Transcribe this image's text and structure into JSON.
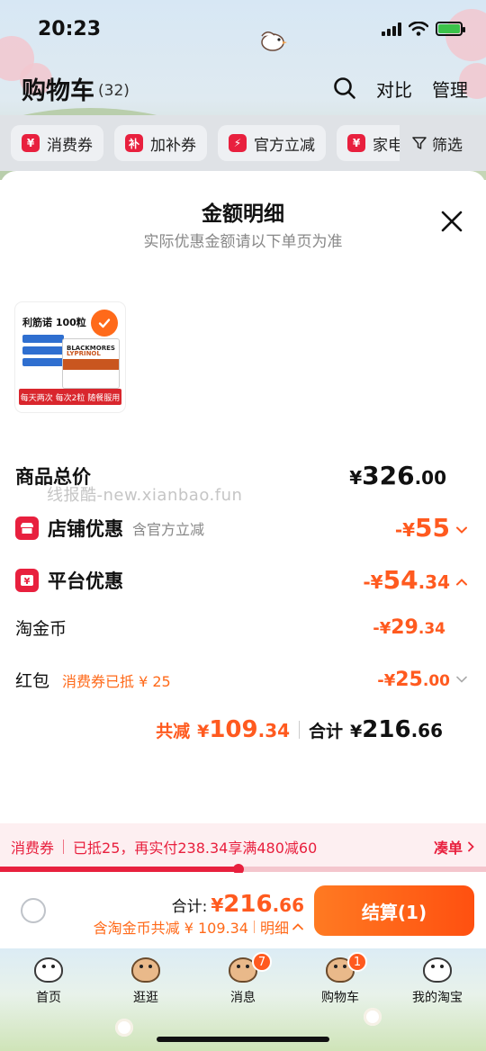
{
  "status_bar": {
    "time": "20:23"
  },
  "header": {
    "title": "购物车",
    "count": "(32)",
    "compare": "对比",
    "manage": "管理"
  },
  "chips": [
    {
      "icon_text": "¥",
      "label": "消费券"
    },
    {
      "icon_text": "补",
      "label": "加补券"
    },
    {
      "icon_text": "⚡",
      "label": "官方立减"
    },
    {
      "icon_text": "¥",
      "label": "家电"
    }
  ],
  "filter_label": "筛选",
  "sheet": {
    "title": "金额明细",
    "subtitle": "实际优惠金额请以下单页为准",
    "watermark": "线报酷-new.xianbao.fun",
    "product": {
      "name": "利筋诺 100粒",
      "brand": "BLACKMORES",
      "subbrand": "LYPRINOL",
      "footer": "每天两次 每次2粒 随餐服用"
    },
    "rows": {
      "goods_total": {
        "label": "商品总价",
        "cur": "¥",
        "int": "326",
        "dec": ".00"
      },
      "shop_discount": {
        "label": "店铺优惠",
        "note": "含官方立减",
        "prefix": "-¥",
        "int": "55",
        "dec": ""
      },
      "platform_discount": {
        "label": "平台优惠",
        "prefix": "-¥",
        "int": "54",
        "dec": ".34"
      },
      "coins": {
        "label": "淘金币",
        "prefix": "-¥",
        "int": "29",
        "dec": ".34"
      },
      "red_packet": {
        "label": "红包",
        "note": "消费券已抵 ¥ 25",
        "prefix": "-¥",
        "int": "25",
        "dec": ".00"
      }
    },
    "summary": {
      "saved_label": "共减",
      "saved_cur": "¥",
      "saved_int": "109",
      "saved_dec": ".34",
      "total_label": "合计",
      "total_cur": "¥",
      "total_int": "216",
      "total_dec": ".66"
    }
  },
  "voucher_bar": {
    "tag": "消费券",
    "text": "已抵25，再实付238.34享满480减60",
    "link": "凑单",
    "progress": 0.49
  },
  "checkout": {
    "sum_label": "合计:",
    "sum_cur": "¥",
    "sum_int": "216",
    "sum_dec": ".66",
    "detail_text": "含淘金币共减 ¥ 109.34",
    "detail_link": "明细",
    "pay_button": "结算(1)"
  },
  "tabs": [
    {
      "label": "首页",
      "badge": ""
    },
    {
      "label": "逛逛",
      "badge": ""
    },
    {
      "label": "消息",
      "badge": "7"
    },
    {
      "label": "购物车",
      "badge": "1"
    },
    {
      "label": "我的淘宝",
      "badge": ""
    }
  ],
  "colors": {
    "accent_orange": "#ff5a1f",
    "taobao_red": "#e8203e"
  }
}
